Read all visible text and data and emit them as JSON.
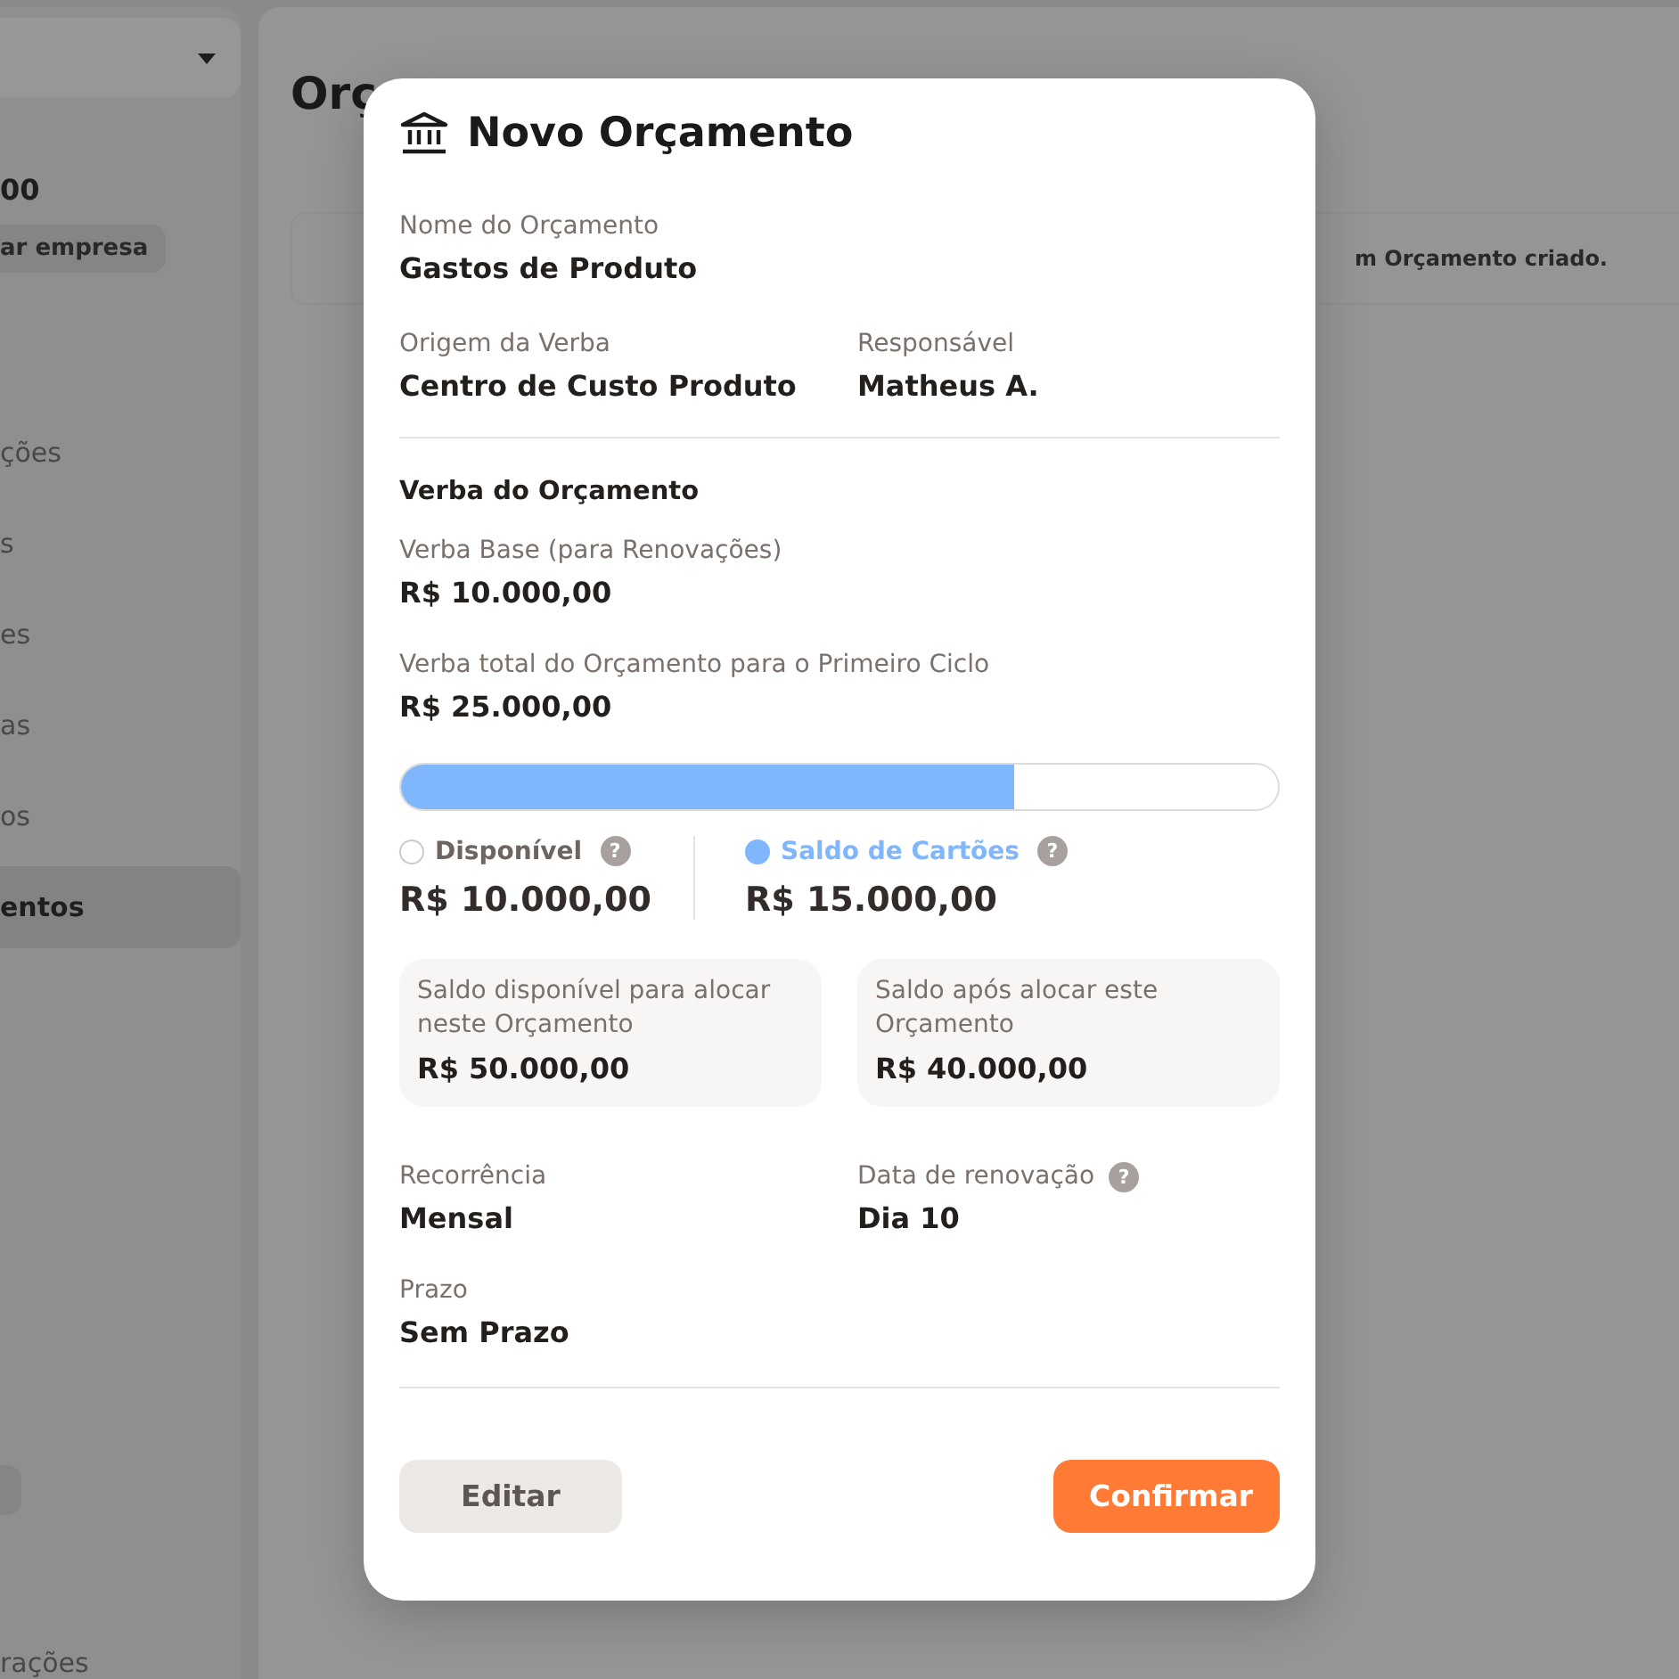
{
  "sidebar": {
    "company_value": "00",
    "company_button": "ar empresa",
    "nav_items": [
      {
        "label": "ções",
        "selected": false
      },
      {
        "label": "s",
        "selected": false
      },
      {
        "label": "es",
        "selected": false
      },
      {
        "label": "as",
        "selected": false
      },
      {
        "label": "os",
        "selected": false
      },
      {
        "label": "entos",
        "selected": true
      }
    ],
    "footer_item": "rações"
  },
  "main": {
    "title": "Orç",
    "notice": "m Orçamento criado."
  },
  "modal": {
    "title": "Novo Orçamento",
    "fields_top": [
      {
        "label": "Nome do Orçamento",
        "value": "Gastos de Produto"
      }
    ],
    "fields_pair": [
      {
        "label": "Origem da Verba",
        "value": "Centro de Custo Produto"
      },
      {
        "label": "Responsável",
        "value": "Matheus A."
      }
    ],
    "section_title": "Verba do Orçamento",
    "amount_fields": [
      {
        "label": "Verba Base (para Renovações)",
        "value": "R$ 10.000,00"
      },
      {
        "label": "Verba total do Orçamento para o Primeiro Ciclo",
        "value": "R$ 25.000,00"
      }
    ],
    "bar": {
      "level": 0.7
    },
    "legend": [
      {
        "label": "Disponível",
        "value": "R$ 10.000,00",
        "color": "#ffffff",
        "help": "?"
      },
      {
        "label": "Saldo de Cartões",
        "value": "R$ 15.000,00",
        "color": "#7fb6fc",
        "help": "?"
      }
    ],
    "cards": [
      {
        "label": "Saldo disponível para alocar neste Orçamento",
        "value": "R$ 50.000,00"
      },
      {
        "label": "Saldo após alocar este Orçamento",
        "value": "R$ 40.000,00"
      }
    ],
    "schedule": [
      {
        "label": "Recorrência",
        "value": "Mensal"
      },
      {
        "label": "Data de renovação",
        "value": "Dia 10",
        "help": "?"
      }
    ],
    "deadline": {
      "label": "Prazo",
      "value": "Sem Prazo"
    },
    "buttons": [
      {
        "kind": "secondary",
        "label": "Editar"
      },
      {
        "kind": "primary",
        "label": "Confirmar"
      }
    ]
  }
}
